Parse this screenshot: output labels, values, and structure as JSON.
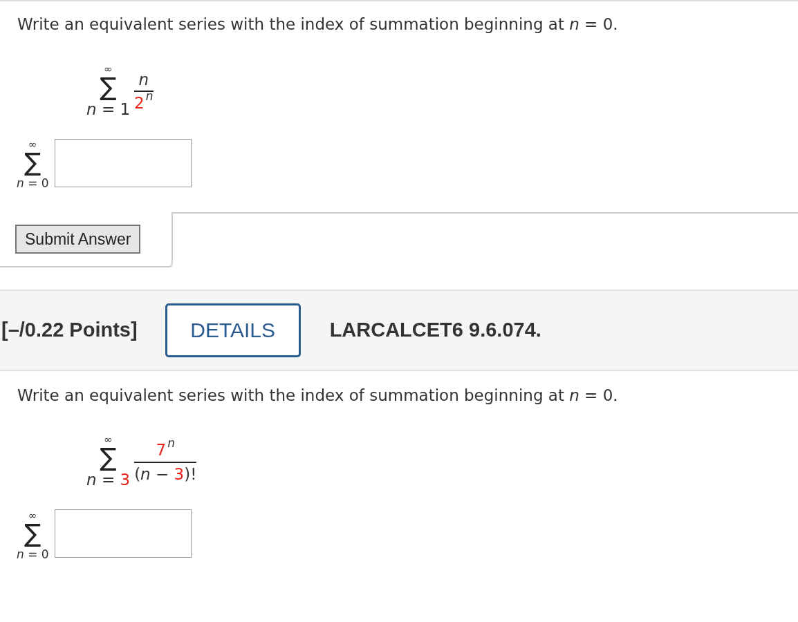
{
  "questions": [
    {
      "prompt": "Write an equivalent series with the index of summation beginning at *n* = 0.",
      "given": {
        "sigma": "∑",
        "upper": "∞",
        "lower": [
          {
            "text": "*n* = 1",
            "color": "#333333"
          }
        ],
        "numerator": [
          {
            "text": "*n*",
            "color": "#333333",
            "kind": "base"
          }
        ],
        "denominator": [
          {
            "text": "2",
            "color": "#e8251c",
            "kind": "base"
          },
          {
            "text": "*n*",
            "color": "#333333",
            "kind": "sup"
          }
        ]
      },
      "answer": {
        "sigma": "∑",
        "upper": "∞",
        "lower": "*n* = 0"
      },
      "submit": "Submit Answer"
    },
    {
      "header": {
        "points": "[–/0.22 Points]",
        "details": "DETAILS",
        "code": "LARCALCET6 9.6.074."
      },
      "prompt": "Write an equivalent series with the index of summation beginning at *n* = 0.",
      "given": {
        "sigma": "∑",
        "upper": "∞",
        "lower": [
          {
            "text": "*n* = ",
            "color": "#333333"
          },
          {
            "text": "3",
            "color": "#e8251c"
          }
        ],
        "numerator": [
          {
            "text": "7",
            "color": "#e8251c",
            "kind": "base"
          },
          {
            "text": "*n*",
            "color": "#333333",
            "kind": "sup"
          }
        ],
        "denominator": [
          {
            "text": "(*n* − ",
            "color": "#333333",
            "kind": "base"
          },
          {
            "text": "3",
            "color": "#e8251c",
            "kind": "base"
          },
          {
            "text": ")!",
            "color": "#333333",
            "kind": "base"
          }
        ]
      },
      "answer": {
        "sigma": "∑",
        "upper": "∞",
        "lower": "*n* = 0"
      }
    }
  ]
}
